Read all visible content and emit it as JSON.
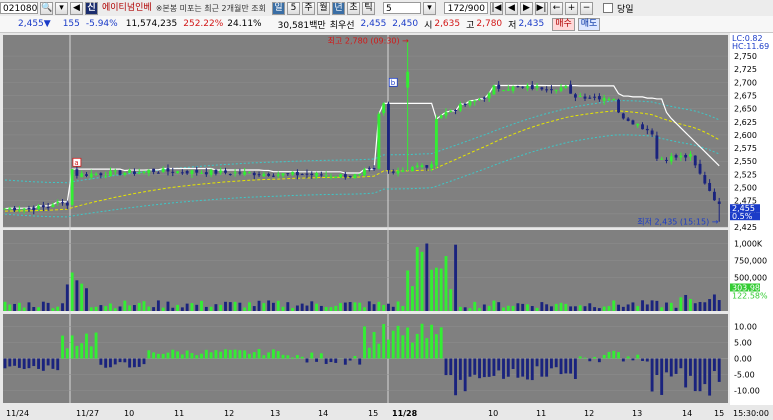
{
  "toolbar": {
    "code": "021080",
    "stock_name": "에이티넘인베",
    "ticker_note": "※본봉 미포는 최근 2개월만 조회",
    "period_buttons": [
      "일",
      "5",
      "주",
      "월",
      "년",
      "초",
      "틱"
    ],
    "period_selected": "일",
    "interval_value": "5",
    "count_text": "172/900",
    "today_label": "당일"
  },
  "info": {
    "price": "2,455",
    "change": "155",
    "change_pct": "-5.94%",
    "volume": "11,574,235",
    "vol_ratio": "252.22%",
    "turnover": "24.11%",
    "amount": "30,581백만",
    "priority_label": "최우선",
    "ask": "2,455",
    "bid": "2,450",
    "open_label": "시",
    "open": "2,635",
    "high_label": "고",
    "high": "2,780",
    "low_label": "저",
    "low": "2,435",
    "buy_label": "매수",
    "sell_label": "매도"
  },
  "colors": {
    "up": "#33ee33",
    "down": "#1a237e",
    "background": "#808080",
    "price_line": "#ffffff",
    "ma_long": "#e6e600",
    "envelope": "#3cc8c8"
  },
  "chart_data": {
    "type": "candlestick",
    "price_axis": {
      "ticks": [
        2425,
        2450,
        2475,
        2500,
        2525,
        2550,
        2575,
        2600,
        2625,
        2650,
        2675,
        2700,
        2725,
        2750
      ],
      "range": [
        2425,
        2790
      ]
    },
    "volume_axis": {
      "ticks": [
        "500,000",
        "750,000",
        "1,000K"
      ],
      "range": [
        0,
        1200000
      ]
    },
    "osc_axis": {
      "ticks": [
        10,
        5,
        0,
        -5,
        -10
      ],
      "range": [
        -14,
        14
      ]
    },
    "x_labels": [
      "11/24",
      "11/27",
      "10",
      "11",
      "12",
      "13",
      "14",
      "15",
      "11/28",
      "10",
      "11",
      "12",
      "13",
      "14",
      "15",
      "15:30:00"
    ],
    "indicator_labels": {
      "lc": "LC:0.82",
      "hc": "HC:11.69"
    },
    "price_badges": [
      "2,455",
      "0.5%"
    ],
    "volume_badges": [
      "303,988",
      "122.58%"
    ],
    "annotations": {
      "high": "최고 2,780 (09:30)",
      "low": "최저 2,435 (15:15)",
      "marker_a": "a",
      "marker_b": "b"
    }
  }
}
